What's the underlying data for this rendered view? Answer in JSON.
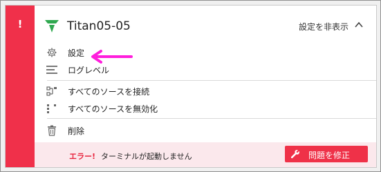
{
  "alert": {
    "mark": "!"
  },
  "header": {
    "title": "Titan05-05",
    "hide_settings_label": "設定を非表示"
  },
  "menu": {
    "items": [
      {
        "label": "設定",
        "icon": "gear-icon"
      },
      {
        "label": "ログレベル",
        "icon": "log-lines-icon"
      },
      {
        "label": "すべてのソースを接続",
        "icon": "connect-sources-icon"
      },
      {
        "label": "すべてのソースを無効化",
        "icon": "disable-sources-icon"
      },
      {
        "label": "削除",
        "icon": "trash-icon"
      }
    ]
  },
  "error": {
    "label": "エラー!",
    "message": "ターミナルが起動しません",
    "fix_button_label": "問題を修正"
  },
  "colors": {
    "alert_red": "#f0304a",
    "error_bg": "#fbe8ec",
    "logo_green": "#2fa84f",
    "annotation_magenta": "#ff1edc"
  }
}
